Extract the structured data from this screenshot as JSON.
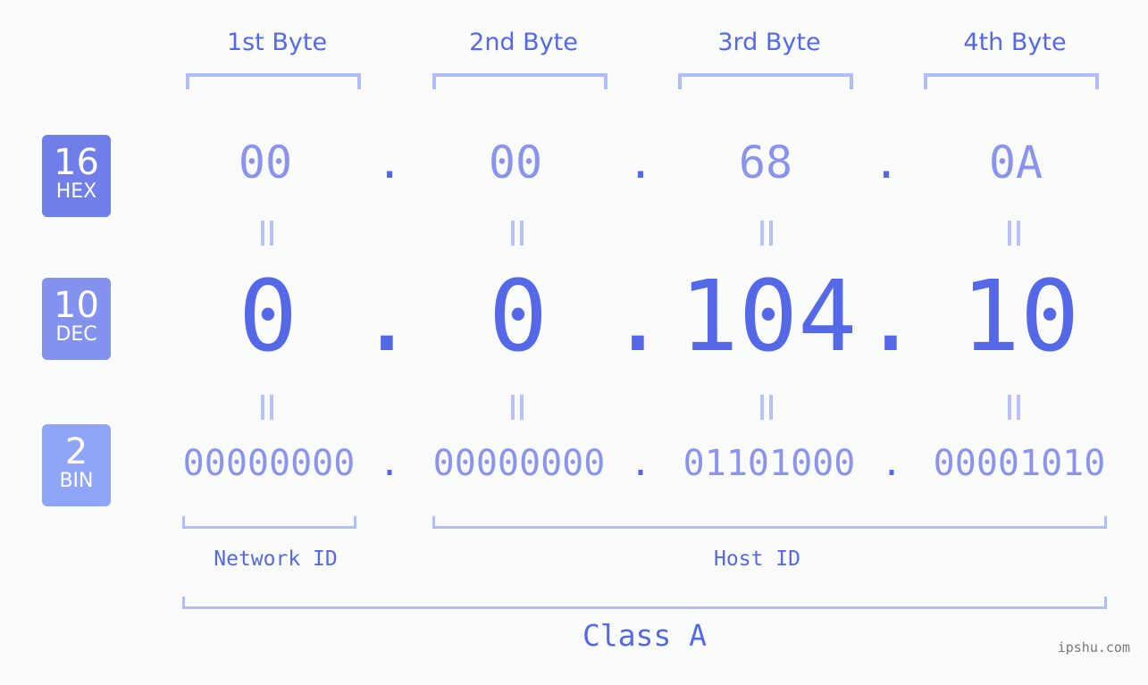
{
  "byte_headers": [
    "1st Byte",
    "2nd Byte",
    "3rd Byte",
    "4th Byte"
  ],
  "badges": {
    "hex": {
      "num": "16",
      "label": "HEX",
      "color": "#6f7ee8"
    },
    "dec": {
      "num": "10",
      "label": "DEC",
      "color": "#8391ef"
    },
    "bin": {
      "num": "2",
      "label": "BIN",
      "color": "#8fa6f8"
    }
  },
  "hex": [
    "00",
    "00",
    "68",
    "0A"
  ],
  "dec": [
    "0",
    "0",
    "104",
    "10"
  ],
  "bin": [
    "00000000",
    "00000000",
    "01101000",
    "00001010"
  ],
  "separator": ".",
  "equals": "=",
  "network_label": "Network ID",
  "host_label": "Host ID",
  "class_label": "Class A",
  "watermark": "ipshu.com",
  "colors": {
    "accent": "#5468e8",
    "light": "#8b94ec",
    "bracket": "#b1bdf6"
  }
}
